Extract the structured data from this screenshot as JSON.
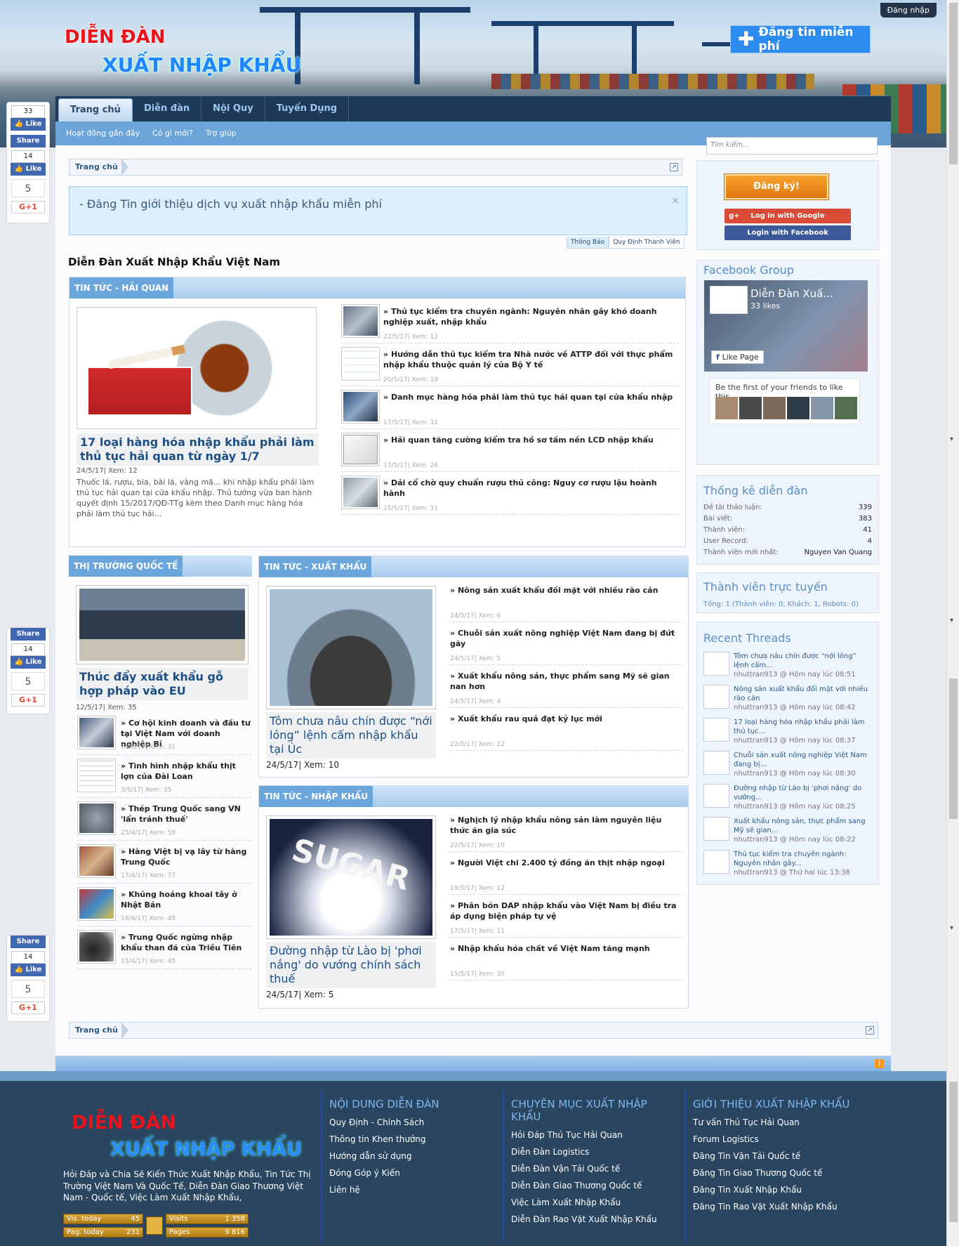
{
  "header": {
    "logo_line1": "DIỄN ĐÀN",
    "logo_line2": "XUẤT NHẬP KHẨU",
    "login": "Đăng nhập",
    "post_free": "Đăng tin miễn phí"
  },
  "nav": {
    "tabs": [
      "Trang chủ",
      "Diễn đàn",
      "Nội Quy",
      "Tuyển Dụng"
    ],
    "sub": [
      "Hoạt động gần đây",
      "Có gì mới?",
      "Trợ giúp"
    ]
  },
  "breadcrumb": {
    "home": "Trang chủ"
  },
  "notice": {
    "text": "- Đăng Tin giới thiệu dịch vụ xuất nhập khẩu miễn phí",
    "tabs": [
      "Thông Báo",
      "Quy Định Thành Viên"
    ]
  },
  "page_title": "Diễn Đàn Xuất Nhập Khẩu Việt Nam",
  "sections": {
    "hai_quan": {
      "label": "TIN TỨC - HẢI QUAN",
      "featured": {
        "title": "17 loại hàng hóa nhập khẩu phải làm thủ tục hải quan từ ngày 1/7",
        "meta": "24/5/17| Xem: 12",
        "excerpt": "Thuốc lá, rượu, bia, bài lá, vàng mã... khi nhập khẩu phải làm thủ tục hải quan tại cửa khẩu nhập. Thủ tướng vừa ban hành quyết định 15/2017/QĐ-TTg kèm theo Danh mục hàng hóa phải làm thủ tục hải..."
      },
      "items": [
        {
          "title": "Thủ tục kiểm tra chuyên ngành: Nguyên nhân gây khó doanh nghiệp xuất, nhập khẩu",
          "meta": "22/5/17| Xem: 12"
        },
        {
          "title": "Hướng dẫn thủ tục kiểm tra Nhà nước về ATTP đối với thực phẩm nhập khẩu thuộc quản lý của Bộ Y tế",
          "meta": "20/5/17| Xem: 19"
        },
        {
          "title": "Danh mục hàng hóa phải làm thủ tục hải quan tại cửa khẩu nhập",
          "meta": "17/5/17| Xem: 31"
        },
        {
          "title": "Hải quan tăng cường kiểm tra hồ sơ tấm nền LCD nhập khẩu",
          "meta": "17/5/17| Xem: 26"
        },
        {
          "title": "Dải cổ chờ quy chuẩn rượu thủ công: Nguy cơ rượu lậu hoành hành",
          "meta": "15/5/17| Xem: 31"
        }
      ]
    },
    "quoc_te": {
      "label": "THỊ TRƯỜNG QUỐC TẾ",
      "featured": {
        "title": "Thúc đẩy xuất khẩu gỗ hợp pháp vào EU",
        "meta": "12/5/17| Xem: 35"
      },
      "items": [
        {
          "title": "Cơ hội kinh doanh và đầu tư tại Việt Nam với doanh nghiệp Bỉ",
          "meta": "11/5/17| Xem: 31"
        },
        {
          "title": "Tình hình nhập khẩu thịt lợn của Đài Loan",
          "meta": "3/5/17| Xem: 35"
        },
        {
          "title": "Thép Trung Quốc sang VN 'lẩn tránh thuế'",
          "meta": "25/4/17| Xem: 59"
        },
        {
          "title": "Hàng Việt bị vạ lây từ hàng Trung Quốc",
          "meta": "17/4/17| Xem: 77"
        },
        {
          "title": "Khủng hoảng khoai tây ở Nhật Bản",
          "meta": "16/4/17| Xem: 48"
        },
        {
          "title": "Trung Quốc ngừng nhập khẩu than đá của Triều Tiên",
          "meta": "15/4/17| Xem: 45"
        }
      ]
    },
    "xuat_khau": {
      "label": "TIN TỨC - XUẤT KHẨU",
      "featured": {
        "title": "Tôm chưa nâu chín được “nới lỏng” lệnh cấm nhập khẩu tại Úc",
        "meta": "24/5/17| Xem: 10"
      },
      "items": [
        {
          "title": "Nông sản xuất khẩu đối mặt với nhiều rào cản",
          "meta": "24/5/17| Xem: 6"
        },
        {
          "title": "Chuỗi sản xuất nông nghiệp Việt Nam đang bị đứt gãy",
          "meta": "24/5/17| Xem: 5"
        },
        {
          "title": "Xuất khẩu nông sản, thực phẩm sang Mỹ sẽ gian nan hơn",
          "meta": "24/5/17| Xem: 4"
        },
        {
          "title": "Xuất khẩu rau quả đạt kỷ lục mới",
          "meta": "22/5/17| Xem: 12"
        }
      ]
    },
    "nhap_khau": {
      "label": "TIN TỨC - NHẬP KHẨU",
      "featured": {
        "title": "Đường nhập từ Lào bị 'phơi nắng' do vướng chính sách thuế",
        "meta": "24/5/17| Xem: 5"
      },
      "items": [
        {
          "title": "Nghịch lý nhập khẩu nông sản làm nguyên liệu thức ăn gia súc",
          "meta": "22/5/17| Xem: 10"
        },
        {
          "title": "Người Việt chi 2.400 tỷ đồng ăn thịt nhập ngoại",
          "meta": "19/5/17| Xem: 12"
        },
        {
          "title": "Phân bón DAP nhập khẩu vào Việt Nam bị điều tra áp dụng biện pháp tự vệ",
          "meta": "17/5/17| Xem: 11"
        },
        {
          "title": "Nhập khẩu hóa chất về Việt Nam tăng mạnh",
          "meta": "15/5/17| Xem: 30"
        }
      ]
    }
  },
  "sidebar": {
    "search_placeholder": "Tìm kiếm...",
    "register": "Đăng ký!",
    "google": "Log in with Google",
    "facebook": "Login with Facebook",
    "fb_group_title": "Facebook Group",
    "fb_page_name": "Diễn Đàn Xuấ...",
    "fb_likes": "33 likes",
    "fb_like_page": "Like Page",
    "fb_friends": "Be the first of your friends to like this",
    "stats_title": "Thống kê diễn đàn",
    "stats": [
      {
        "k": "Đề tài thảo luận:",
        "v": "339"
      },
      {
        "k": "Bài viết:",
        "v": "383"
      },
      {
        "k": "Thành viên:",
        "v": "41"
      },
      {
        "k": "User Record:",
        "v": "4"
      },
      {
        "k": "Thành viên mới nhất:",
        "v": "Nguyen Van Quang"
      }
    ],
    "online_title": "Thành viên trực tuyến",
    "online_text": "Tổng: 1 (Thành viên: 0, Khách: 1, Robots: 0)",
    "recent_title": "Recent Threads",
    "recent": [
      {
        "t": "Tôm chưa nâu chín được “nới lỏng” lệnh cấm...",
        "m": "nhuttran913 @ Hôm nay lúc 08:51"
      },
      {
        "t": "Nông sản xuất khẩu đối mặt với nhiều rào cản",
        "m": "nhuttran913 @ Hôm nay lúc 08:42"
      },
      {
        "t": "17 loại hàng hóa nhập khẩu phải làm thủ tục...",
        "m": "nhuttran913 @ Hôm nay lúc 08:37"
      },
      {
        "t": "Chuỗi sản xuất nông nghiệp Việt Nam đang bị...",
        "m": "nhuttran913 @ Hôm nay lúc 08:30"
      },
      {
        "t": "Đường nhập từ Lào bị 'phơi nắng' do vướng...",
        "m": "nhuttran913 @ Hôm nay lúc 08:25"
      },
      {
        "t": "Xuất khẩu nông sản, thực phẩm sang Mỹ sẽ gian...",
        "m": "nhuttran913 @ Hôm nay lúc 08:22"
      },
      {
        "t": "Thủ tục kiểm tra chuyên ngành: Nguyên nhân gây...",
        "m": "nhuttran913 @ Thứ hai lúc 13:38"
      }
    ]
  },
  "social": [
    {
      "count": "33",
      "like": "Like",
      "share": "Share",
      "share_count": "14",
      "like2": "Like",
      "num": "5",
      "gplus": "G+1"
    },
    {
      "share": "Share",
      "share_count": "14",
      "like2": "Like",
      "num": "5",
      "gplus": "G+1"
    },
    {
      "share": "Share",
      "share_count": "14",
      "like2": "Like",
      "num": "5",
      "gplus": "G+1"
    }
  ],
  "footer": {
    "logo_line1": "DIỄN ĐÀN",
    "logo_line2": "XUẤT NHẬP KHẨU",
    "desc": "Hỏi Đáp và Chia Sẽ Kiến Thức Xuất Nhập Khẩu, Tin Tức Thị Trường Việt Nam Và Quốc Tế, Diễn Đàn Giao Thương Việt Nam - Quốc tế, Việc Làm Xuất Nhập Khẩu,",
    "counters": [
      {
        "k": "Vis. today",
        "v": "45"
      },
      {
        "k": "Visits",
        "v": "1 358"
      },
      {
        "k": "Pag. today",
        "v": "231"
      },
      {
        "k": "Pages",
        "v": "9 816"
      }
    ],
    "cols": [
      {
        "title": "NỘI DUNG DIỄN ĐÀN",
        "links": [
          "Quy Định - Chính Sách",
          "Thông tin Khen thưởng",
          "Hướng dẫn sử dụng",
          "Đóng Góp ý Kiến",
          "Liên hệ"
        ]
      },
      {
        "title": "CHUYÊN MỤC XUẤT NHẬP KHẨU",
        "links": [
          "Hỏi Đáp Thủ Tục Hải Quan",
          "Diễn Đàn Logistics",
          "Diễn Đàn Vận Tải Quốc tế",
          "Diễn Đàn Giao Thương Quốc tế",
          "Việc Làm Xuất Nhập Khẩu",
          "Diễn Đàn Rao Vặt Xuất Nhập Khẩu"
        ]
      },
      {
        "title": "GIỚI THIỆU XUẤT NHẬP KHẨU",
        "links": [
          "Tư vấn Thủ Tục Hải Quan",
          "Forum Logistics",
          "Đăng Tin Vận Tải Quốc tế",
          "Đăng Tin Giao Thương Quốc tế",
          "Đăng Tin Xuất Nhập Khẩu",
          "Đăng Tin Rao Vặt Xuất Nhập Khẩu"
        ]
      }
    ]
  }
}
